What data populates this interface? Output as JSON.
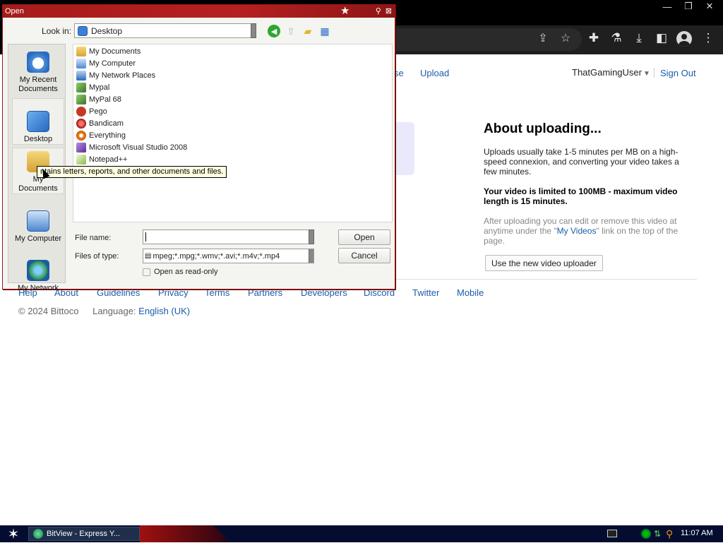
{
  "browser": {
    "window_controls": [
      "—",
      "❐",
      "✕"
    ]
  },
  "page": {
    "nav": {
      "browse": "se",
      "upload": "Upload",
      "user": "ThatGamingUser",
      "sign_out": "Sign Out"
    },
    "about": {
      "title": "About uploading...",
      "p1": "Uploads usually take 1-5 minutes per MB on a high-speed connexion, and converting your video takes a few minutes.",
      "p2": "Your video is limited to 100MB - maximum video length is 15 minutes.",
      "p3_before": "After uploading you can edit or remove this video at anytime under the \"",
      "p3_link": "My Videos",
      "p3_after": "\" link on the top of the page.",
      "new_uploader": "Use the new video uploader"
    },
    "footer": {
      "links": [
        "Help",
        "About",
        "Guidelines",
        "Privacy",
        "Terms",
        "Partners",
        "Developers",
        "Discord",
        "Twitter",
        "Mobile"
      ],
      "copyright": "© 2024 Bittoco",
      "language_label": "Language:",
      "language": "English (UK)"
    }
  },
  "dialog": {
    "title": "Open",
    "look_in_label": "Look in:",
    "look_in_value": "Desktop",
    "places": [
      "My Recent Documents",
      "Desktop",
      "My Documents",
      "My Computer",
      "My Network"
    ],
    "files": [
      "My Documents",
      "My Computer",
      "My Network Places",
      "Mypal",
      "MyPal 68",
      "Pego",
      "Bandicam",
      "Everything",
      "Microsoft Visual Studio 2008",
      "Notepad++"
    ],
    "file_name_label": "File name:",
    "file_name_value": "",
    "files_of_type_label": "Files of type:",
    "files_of_type_value": "mpeg;*.mpg;*.wmv;*.avi;*.m4v;*.mp4",
    "readonly_label": "Open as read-only",
    "open_button": "Open",
    "cancel_button": "Cancel",
    "tooltip": "ntains letters, reports, and other documents and files."
  },
  "taskbar": {
    "task_label": "BitView - Express Y...",
    "clock": "11:07 AM"
  }
}
